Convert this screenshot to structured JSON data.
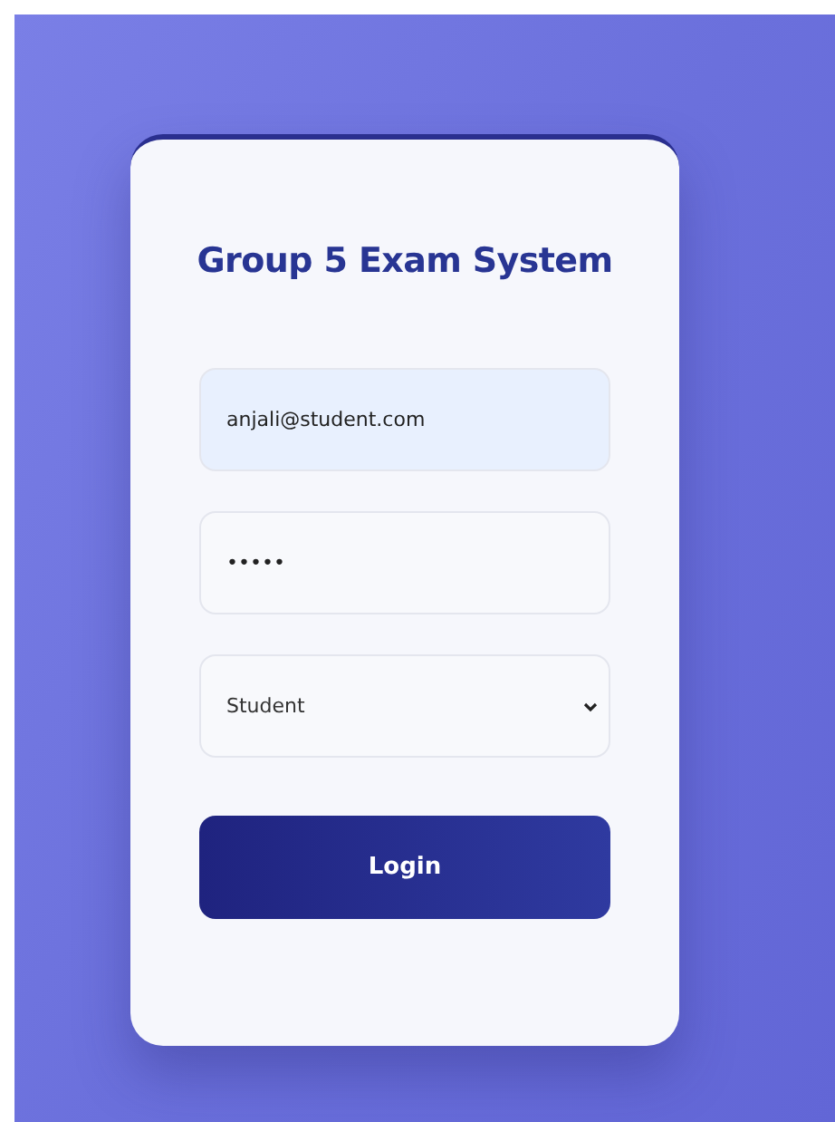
{
  "card": {
    "title": "Group 5 Exam System"
  },
  "fields": [
    {
      "kind": "email",
      "value": "anjali@student.com",
      "autofilled": true
    },
    {
      "kind": "password",
      "value": "•••••",
      "autofilled": false
    },
    {
      "kind": "select",
      "value": "Student",
      "autofilled": false
    }
  ],
  "login_button": {
    "label": "Login"
  }
}
